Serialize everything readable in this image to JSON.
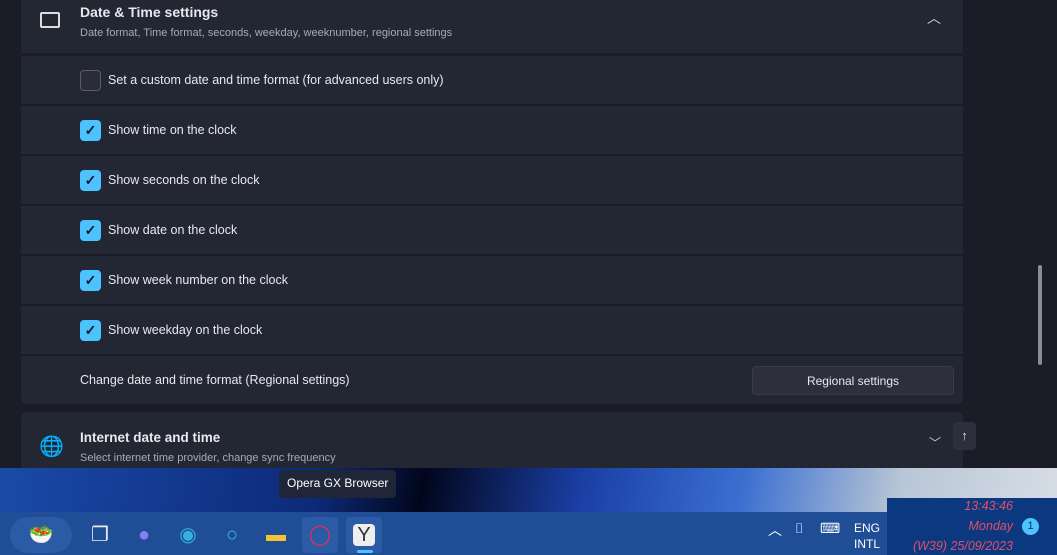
{
  "section": {
    "title": "Date & Time settings",
    "subtitle": "Date format, Time format, seconds, weekday, weeknumber, regional settings"
  },
  "options": [
    {
      "label": "Set a custom date and time format (for advanced users only)",
      "checked": false
    },
    {
      "label": "Show time on the clock",
      "checked": true
    },
    {
      "label": "Show seconds on the clock",
      "checked": true
    },
    {
      "label": "Show date on the clock",
      "checked": true
    },
    {
      "label": "Show week number on the clock",
      "checked": true
    },
    {
      "label": "Show weekday on the clock",
      "checked": true
    }
  ],
  "regional": {
    "label": "Change date and time format (Regional settings)",
    "button": "Regional settings"
  },
  "internet": {
    "title": "Internet date and time",
    "subtitle": "Select internet time provider, change sync frequency"
  },
  "tooltip": "Opera GX Browser",
  "tray": {
    "lang1": "ENG",
    "lang2": "INTL",
    "time": "13:43:46",
    "weekday": "Monday",
    "date": "(W39) 25/09/2023",
    "notifications": "1"
  },
  "colors": {
    "accent": "#4cc2ff",
    "clock_text": "#e0506a"
  }
}
